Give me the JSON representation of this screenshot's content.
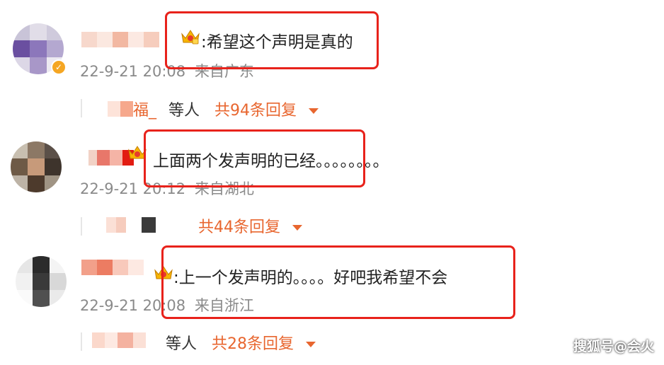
{
  "comments": [
    {
      "text": ":希望这个声明是真的",
      "time": "22-9-21 20:08",
      "location": "来自广东",
      "reply_prefix": "福_",
      "reply_label": "等人",
      "reply_count": "共94条回复"
    },
    {
      "text": "上面两个发声明的已经。。。。。。。。",
      "time": "22-9-21 20:12",
      "location": "来自湖北",
      "reply_prefix": "",
      "reply_label": "",
      "reply_count": "共44条回复"
    },
    {
      "text": ":上一个发声明的。。。。好吧我希望不会",
      "time": "22-9-21 20:08",
      "location": "来自浙江",
      "reply_prefix": "",
      "reply_label": "等人",
      "reply_count": "共28条回复"
    }
  ],
  "watermark": "搜狐号@会火",
  "colors": {
    "accent": "#e8662f",
    "highlight": "#e8221b",
    "meta": "#8a8a8a",
    "verified": "#f5a623"
  }
}
